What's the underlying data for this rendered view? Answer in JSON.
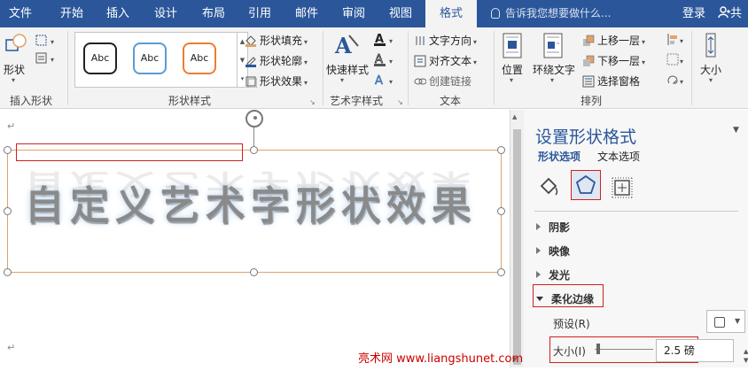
{
  "tabs": [
    {
      "label": "文件"
    },
    {
      "label": "开始"
    },
    {
      "label": "插入"
    },
    {
      "label": "设计"
    },
    {
      "label": "布局"
    },
    {
      "label": "引用"
    },
    {
      "label": "邮件"
    },
    {
      "label": "审阅"
    },
    {
      "label": "视图"
    },
    {
      "label": "格式",
      "active": true
    }
  ],
  "tell_me": "告诉我您想要做什么...",
  "login": "登录",
  "share": "共",
  "ribbon": {
    "insert_shape": {
      "shape_btn": "形状",
      "group": "插入形状"
    },
    "shape_styles": {
      "samples": [
        "Abc",
        "Abc",
        "Abc"
      ],
      "fill": "形状填充",
      "outline": "形状轮廓",
      "effects": "形状效果",
      "group": "形状样式"
    },
    "wordart": {
      "quick_styles": "快速样式",
      "group": "艺术字样式"
    },
    "text": {
      "direction": "文字方向",
      "align": "对齐文本",
      "link": "创建链接",
      "group": "文本"
    },
    "arrange": {
      "position": "位置",
      "wrap": "环绕文字",
      "bring_forward": "上移一层",
      "send_backward": "下移一层",
      "selection_pane": "选择窗格",
      "group": "排列"
    },
    "size": {
      "label": "大小"
    }
  },
  "document": {
    "wordart_text": "自定义艺术字形状效果"
  },
  "pane": {
    "title": "设置形状格式",
    "tab_shape": "形状选项",
    "tab_text": "文本选项",
    "sections": {
      "shadow": "阴影",
      "reflection": "映像",
      "glow": "发光",
      "soft_edges": "柔化边缘"
    },
    "preset_label": "预设(R)",
    "size_label": "大小(I)",
    "size_value": "2.5 磅"
  },
  "watermark": "亮术网 www.liangshunet.com",
  "colors": {
    "accent": "#2b579a",
    "highlight": "#d02020",
    "shape_border": "#e0a26a"
  }
}
